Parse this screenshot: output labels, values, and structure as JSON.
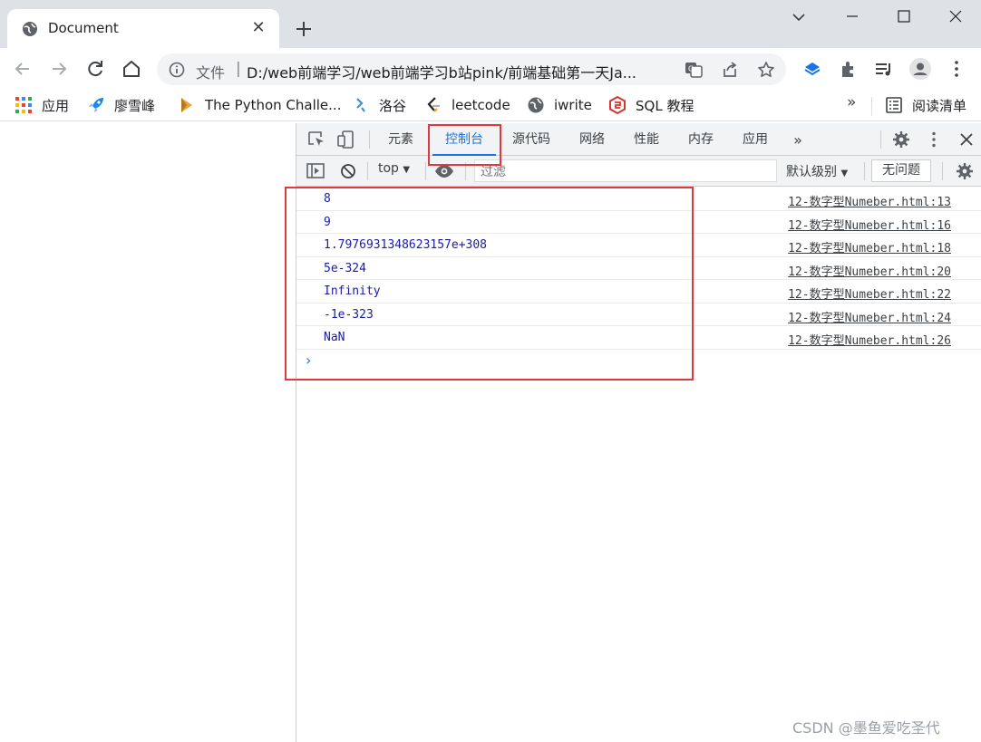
{
  "browser": {
    "tab": {
      "title": "Document"
    },
    "address": {
      "scheme_label": "文件",
      "separator": "|",
      "url": "D:/web前端学习/web前端学习b站pink/前端基础第一天Ja..."
    }
  },
  "bookmarks": [
    {
      "label": "应用",
      "icon": "apps-grid-icon"
    },
    {
      "label": "廖雪峰",
      "icon": "rocket-icon"
    },
    {
      "label": "The Python Challe...",
      "icon": "python-challenge-icon"
    },
    {
      "label": "洛谷",
      "icon": "luogu-icon"
    },
    {
      "label": "leetcode",
      "icon": "leetcode-icon"
    },
    {
      "label": "iwrite",
      "icon": "globe-icon"
    },
    {
      "label": "SQL 教程",
      "icon": "sql-icon"
    }
  ],
  "bookmarks_more": "»",
  "reading_list": "阅读清单",
  "devtools": {
    "tabs": [
      {
        "label": "元素"
      },
      {
        "label": "控制台",
        "active": true
      },
      {
        "label": "源代码"
      },
      {
        "label": "网络"
      },
      {
        "label": "性能"
      },
      {
        "label": "内存"
      },
      {
        "label": "应用"
      }
    ],
    "tabs_more": "»",
    "console_bar": {
      "context": "top",
      "filter_placeholder": "过滤",
      "level": "默认级别",
      "issues": "无问题"
    },
    "console_rows": [
      {
        "value": "8",
        "source": "12-数字型Numeber.html:13"
      },
      {
        "value": "9",
        "source": "12-数字型Numeber.html:16"
      },
      {
        "value": "1.7976931348623157e+308",
        "source": "12-数字型Numeber.html:18"
      },
      {
        "value": "5e-324",
        "source": "12-数字型Numeber.html:20"
      },
      {
        "value": "Infinity",
        "source": "12-数字型Numeber.html:22"
      },
      {
        "value": "-1e-323",
        "source": "12-数字型Numeber.html:24"
      },
      {
        "value": "NaN",
        "source": "12-数字型Numeber.html:26"
      }
    ],
    "prompt": "›"
  },
  "watermark": "CSDN @墨鱼爱吃圣代",
  "colors": {
    "accent": "#1a73e8",
    "highlight": "#e0383e",
    "console_value": "#1a1aa6"
  }
}
